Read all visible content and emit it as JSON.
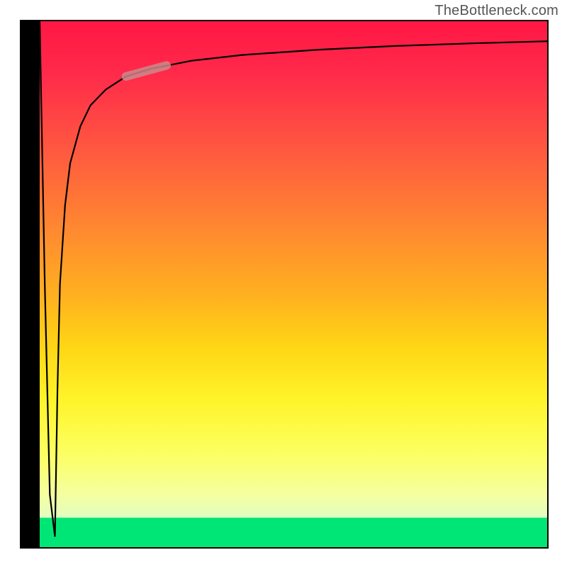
{
  "attribution": "TheBottleneck.com",
  "chart_data": {
    "type": "line",
    "title": "",
    "xlabel": "",
    "ylabel": "",
    "xlim": [
      0,
      100
    ],
    "ylim": [
      0,
      100
    ],
    "grid": false,
    "legend": false,
    "series": [
      {
        "name": "curve-descend",
        "x": [
          0,
          1,
          2,
          3
        ],
        "values": [
          100,
          50,
          10,
          2
        ]
      },
      {
        "name": "curve-ascend",
        "x": [
          3,
          3.5,
          4,
          5,
          6,
          8,
          10,
          13,
          17,
          22,
          30,
          40,
          55,
          70,
          85,
          100
        ],
        "values": [
          2,
          30,
          50,
          65,
          73,
          80,
          84,
          87,
          89.5,
          91,
          92.5,
          93.6,
          94.6,
          95.3,
          95.8,
          96.2
        ]
      }
    ],
    "highlight": {
      "x_start": 17,
      "x_end": 25,
      "y_start": 89.5,
      "y_end": 91.6
    },
    "colors": {
      "gradient_top": "#ff1744",
      "gradient_mid": "#fff42a",
      "gradient_bottom": "#00e676",
      "curve": "#000000",
      "highlight": "#cc8c8c",
      "frame": "#000000"
    }
  }
}
